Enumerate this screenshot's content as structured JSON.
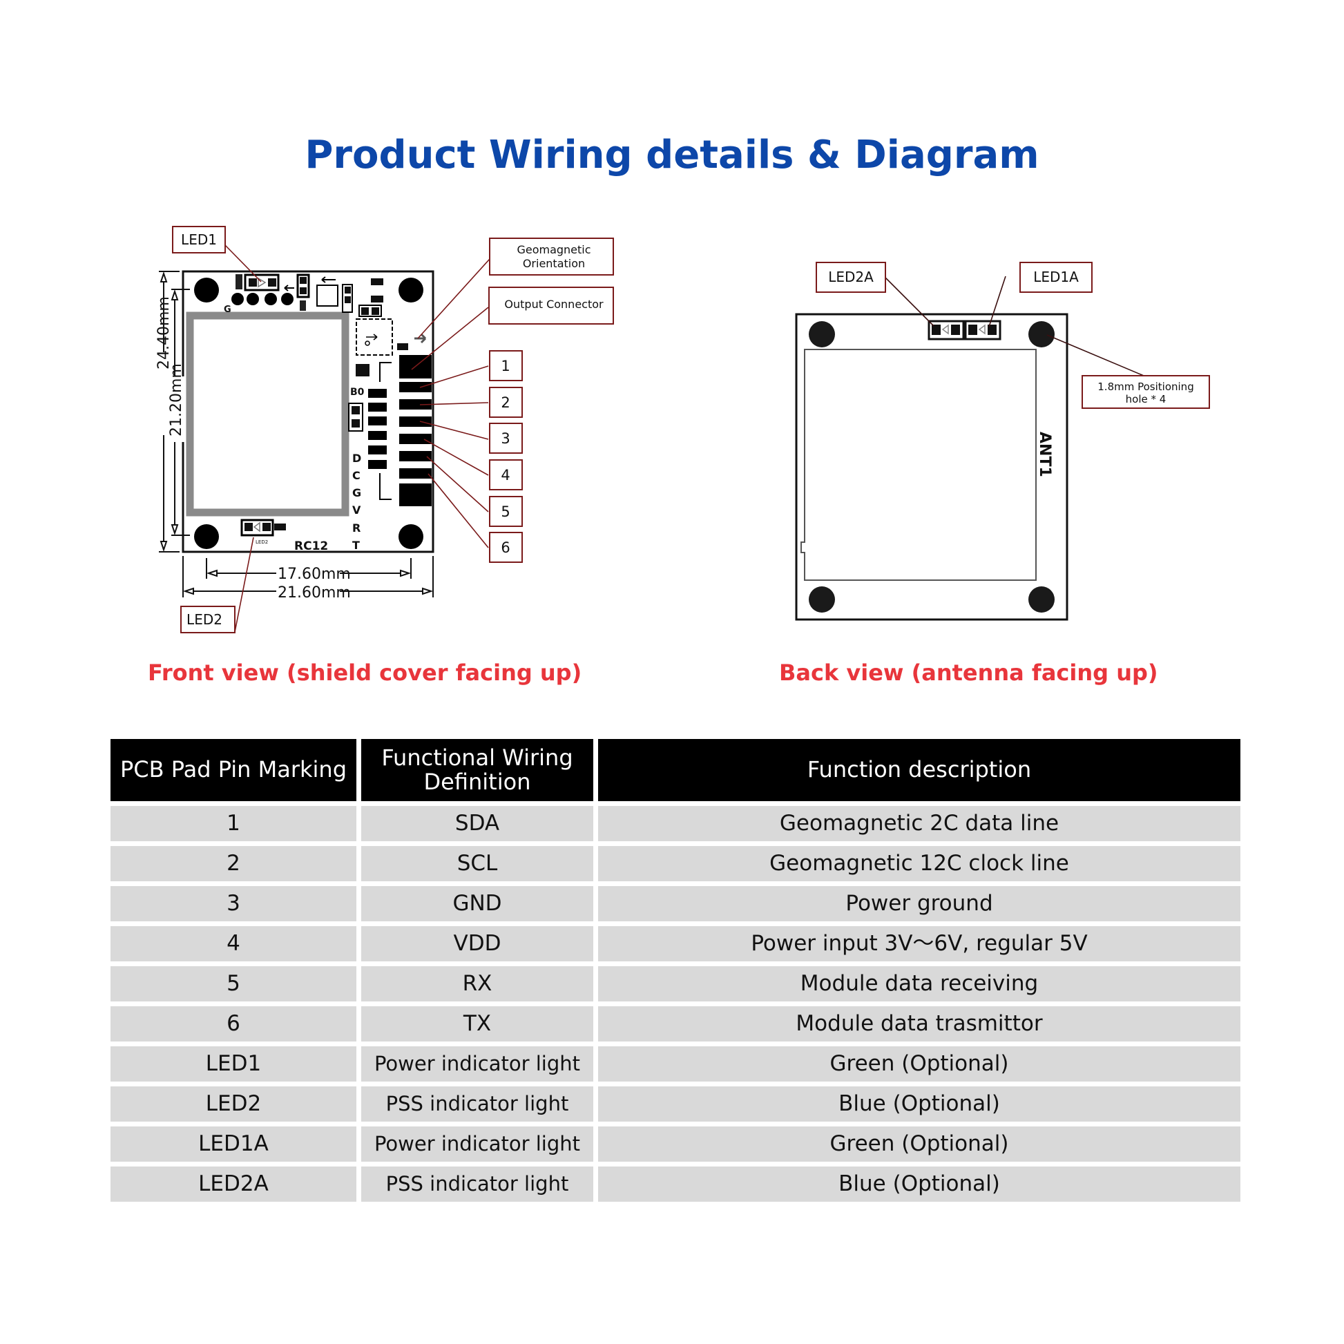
{
  "title": "Product Wiring details & Diagram",
  "colors": {
    "title": "#0d47a9",
    "caption": "#e8353b",
    "callout_border": "#7a1a1a",
    "header_bg": "#000000",
    "row_bg": "#d9d9d9"
  },
  "front_view": {
    "caption": "Front view (shield cover facing up)",
    "callouts": {
      "led1": "LED1",
      "led2": "LED2",
      "geomagnetic": [
        "Geomagnetic",
        "Orientation"
      ],
      "output_connector": "Output Connector",
      "pins": [
        "1",
        "2",
        "3",
        "4",
        "5",
        "6"
      ]
    },
    "dimensions": {
      "height_outer": "24.40mm",
      "height_inner": "21.20mm",
      "width_inner": "17.60mm",
      "width_outer": "21.60mm"
    },
    "silkscreen": {
      "board_name": "RC12",
      "b0": "B0",
      "g": "G",
      "pin_letters": [
        "D",
        "C",
        "G",
        "V",
        "R",
        "T"
      ],
      "led2_small": "LED2"
    }
  },
  "back_view": {
    "caption": "Back view (antenna facing up)",
    "callouts": {
      "led2a": "LED2A",
      "led1a": "LED1A",
      "hole": [
        "1.8mm Positioning",
        "hole * 4"
      ]
    },
    "antenna_label": "ANT1"
  },
  "table": {
    "headers": [
      "PCB Pad Pin Marking",
      "Functional Wiring Definition",
      "Function description"
    ],
    "rows": [
      [
        "1",
        "SDA",
        "Geomagnetic 2C data line"
      ],
      [
        "2",
        "SCL",
        "Geomagnetic 12C clock line"
      ],
      [
        "3",
        "GND",
        "Power ground"
      ],
      [
        "4",
        "VDD",
        "Power input 3V～6V, regular 5V"
      ],
      [
        "5",
        "RX",
        "Module data receiving"
      ],
      [
        "6",
        "TX",
        "Module data trasmittor"
      ],
      [
        "LED1",
        "Power indicator light",
        "Green (Optional)"
      ],
      [
        "LED2",
        "PSS indicator light",
        "Blue (Optional)"
      ],
      [
        "LED1A",
        "Power indicator light",
        "Green (Optional)"
      ],
      [
        "LED2A",
        "PSS indicator light",
        "Blue (Optional)"
      ]
    ]
  }
}
